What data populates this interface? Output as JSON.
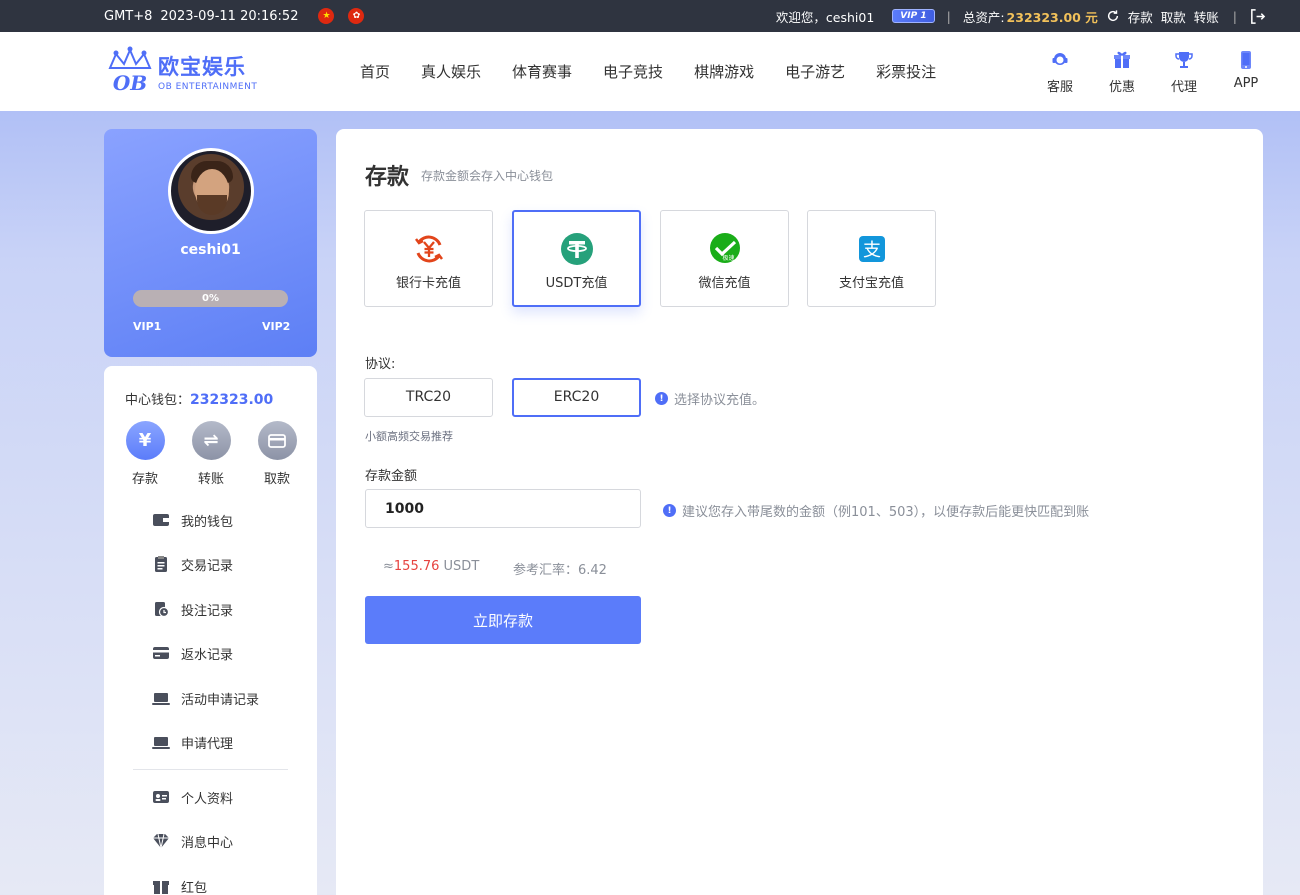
{
  "topbar": {
    "timezone": "GMT+8",
    "datetime": "2023-09-11 20:16:52",
    "welcome": "欢迎您，ceshi01",
    "vip_badge": "VIP 1",
    "sep": "|",
    "assets_label": "总资产:",
    "assets_value": "232323.00 元",
    "links": [
      "存款",
      "取款",
      "转账"
    ]
  },
  "header": {
    "logo_cn": "欧宝娱乐",
    "logo_en": "OB ENTERTAINMENT",
    "nav": [
      "首页",
      "真人娱乐",
      "体育赛事",
      "电子竞技",
      "棋牌游戏",
      "电子游艺",
      "彩票投注"
    ],
    "quick": [
      "客服",
      "优惠",
      "代理",
      "APP"
    ]
  },
  "profile": {
    "username": "ceshi01",
    "progress": "0%",
    "vip_current": "VIP1",
    "vip_next": "VIP2"
  },
  "menu": {
    "wallet_label": "中心钱包：",
    "wallet_value": "232323.00",
    "actions": [
      "存款",
      "转账",
      "取款"
    ],
    "action_icons": [
      "yen-icon",
      "transfer-icon",
      "card-icon"
    ],
    "items": [
      "我的钱包",
      "交易记录",
      "投注记录",
      "返水记录",
      "活动申请记录",
      "申请代理",
      "个人资料",
      "消息中心",
      "红包"
    ]
  },
  "deposit": {
    "title": "存款",
    "subtitle": "存款金额会存入中心钱包",
    "methods": [
      "银行卡充值",
      "USDT充值",
      "微信充值",
      "支付宝充值"
    ],
    "protocol_label": "协议:",
    "protocols": [
      "TRC20",
      "ERC20"
    ],
    "protocol_hint": "选择协议充值。",
    "protocol_note": "小额高频交易推荐",
    "amount_label": "存款金额",
    "amount_value": "1000",
    "amount_hint": "建议您存入带尾数的金额（例101、503），以便存款后能更快匹配到账",
    "approx_prefix": "≈",
    "approx_value": "155.76",
    "approx_unit": " USDT",
    "rate_text": "参考汇率：6.42",
    "submit_label": "立即存款",
    "wechat_badge": "极速",
    "alipay_glyph": "支"
  },
  "colors": {
    "accent": "#4f6ef7",
    "topbar": "#2f3440",
    "gold": "#f2c15a",
    "red": "#e64340"
  }
}
